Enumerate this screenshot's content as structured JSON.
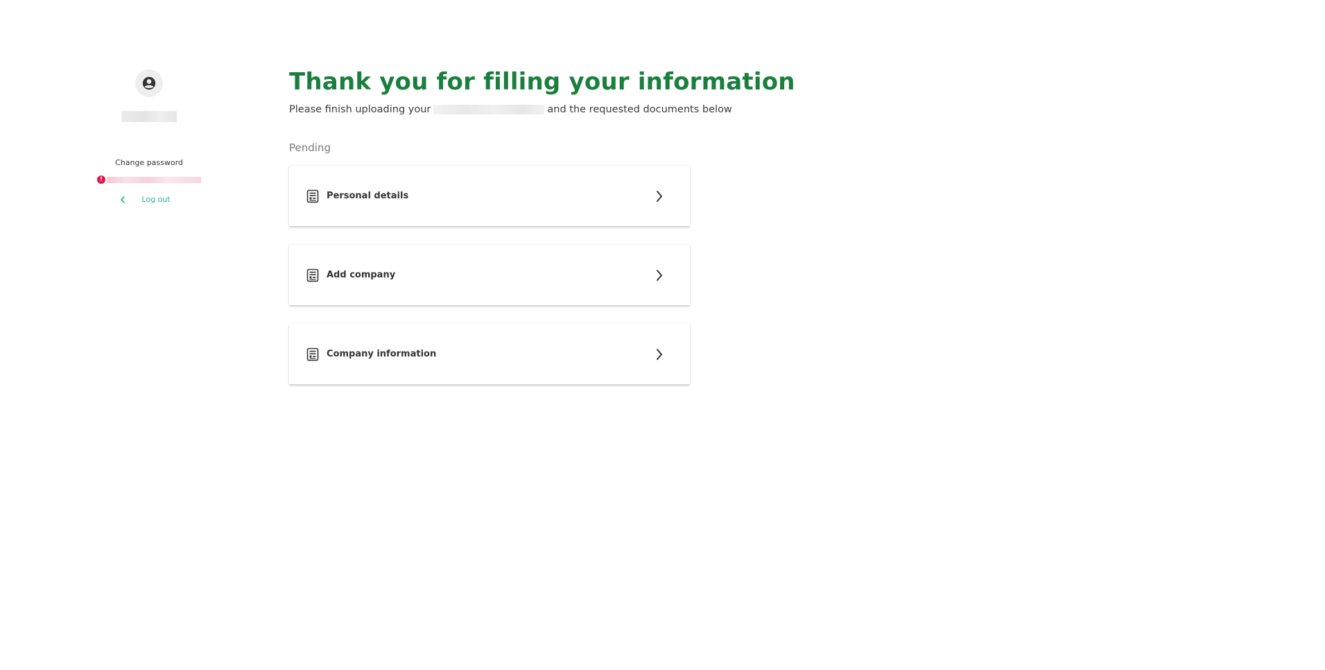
{
  "sidebar": {
    "change_password_label": "Change password",
    "logout_label": "Log out",
    "error_icon_glyph": "!",
    "accent_color": "#24b491",
    "error_color": "#e0174a"
  },
  "main": {
    "title": "Thank you for filling your information",
    "subtitle_before": "Please finish uploading your",
    "subtitle_after": "and the requested documents below",
    "section_label": "Pending",
    "title_color": "#1a7f3d",
    "tasks": [
      {
        "label": "Personal details",
        "icon": "document-icon",
        "action_icon": "chevron-right-icon"
      },
      {
        "label": "Add company",
        "icon": "document-icon",
        "action_icon": "chevron-right-icon"
      },
      {
        "label": "Company information",
        "icon": "document-icon",
        "action_icon": "chevron-right-icon"
      }
    ]
  }
}
